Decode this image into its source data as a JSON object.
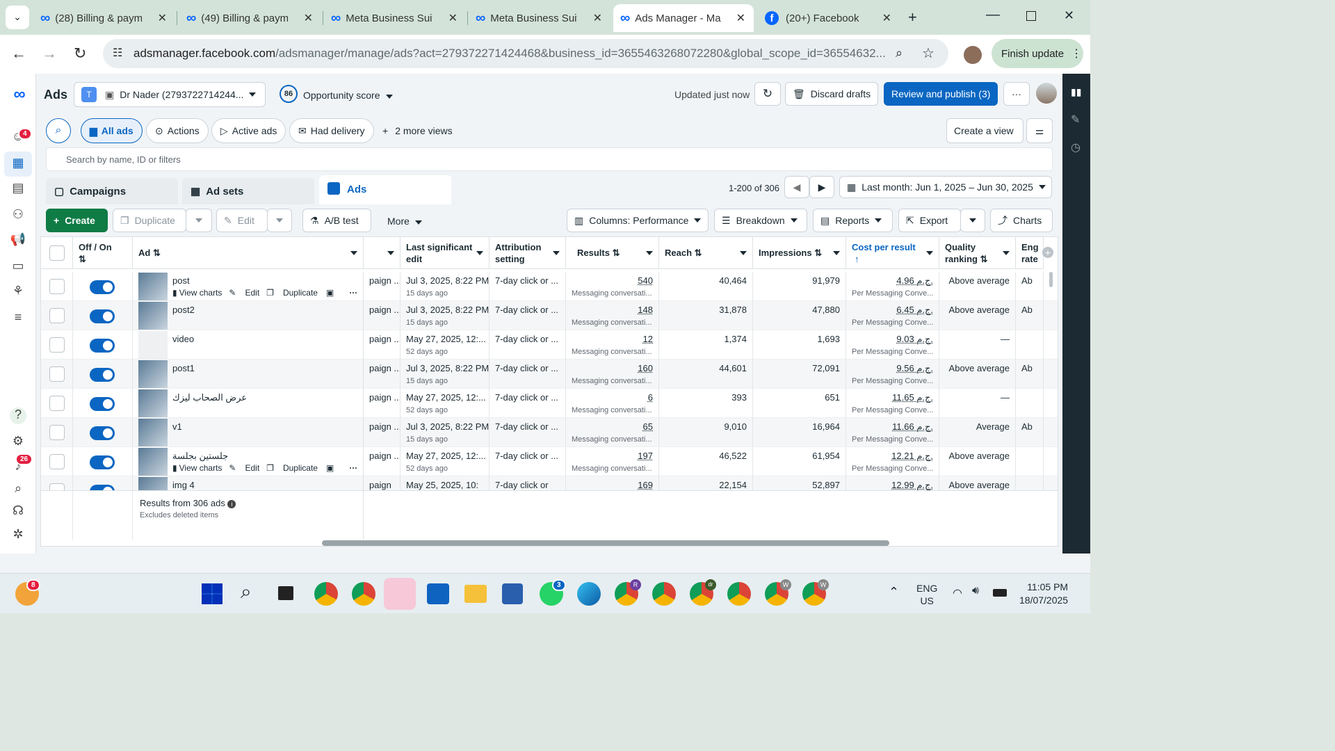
{
  "browser": {
    "tabs": [
      {
        "title": "(28) Billing & paym",
        "icon": "meta-logo-icon"
      },
      {
        "title": "(49) Billing & paym",
        "icon": "meta-logo-icon"
      },
      {
        "title": "Meta Business Suit",
        "icon": "meta-logo-icon"
      },
      {
        "title": "Meta Business Suit",
        "icon": "meta-logo-icon"
      },
      {
        "title": "Ads Manager - Ma",
        "icon": "meta-logo-icon",
        "active": true
      },
      {
        "title": "(20+) Facebook",
        "icon": "facebook-icon"
      }
    ],
    "url_host": "adsmanager.facebook.com",
    "url_path": "/adsmanager/manage/ads?act=279372271424468&business_id=3655463268072280&global_scope_id=36554632...",
    "finish_update": "Finish update"
  },
  "leftnav": {
    "badge_notifications": "4",
    "badge_alerts": "26"
  },
  "header": {
    "title": "Ads",
    "account_initial": "T",
    "account_name": "Dr Nader (2793722714244...",
    "score": "86",
    "opportunity": "Opportunity score",
    "updated": "Updated just now",
    "discard": "Discard drafts",
    "review": "Review and publish (3)",
    "more": "···"
  },
  "views": {
    "all_ads": "All ads",
    "actions": "Actions",
    "active_ads": "Active ads",
    "had_delivery": "Had delivery",
    "more_views": "2 more views",
    "create_view": "Create a view",
    "search_placeholder": "Search by name, ID or filters"
  },
  "level_tabs": {
    "campaigns": "Campaigns",
    "adsets": "Ad sets",
    "ads": "Ads",
    "pagination": "1-200 of 306",
    "date_range": "Last month: Jun 1, 2025 – Jun 30, 2025"
  },
  "toolbar": {
    "create": "Create",
    "duplicate": "Duplicate",
    "edit": "Edit",
    "ab_test": "A/B test",
    "more": "More",
    "columns": "Columns: Performance",
    "breakdown": "Breakdown",
    "reports": "Reports",
    "export": "Export",
    "charts": "Charts"
  },
  "table": {
    "headers": {
      "offon": "Off / On",
      "ad": "Ad",
      "last_edit": "Last significant edit",
      "attribution": "Attribution setting",
      "results": "Results",
      "reach": "Reach",
      "impressions": "Impressions",
      "cpr": "Cost per result",
      "quality": "Quality ranking",
      "eng": "Eng rate"
    },
    "row_actions": {
      "view_charts": "View charts",
      "edit": "Edit",
      "duplicate": "Duplicate"
    },
    "rows": [
      {
        "name": "post",
        "campaign": "paign ...",
        "edit": "Jul 3, 2025, 8:22 PM",
        "edit_ago": "15 days ago",
        "attr": "7-day click or ...",
        "results": "540",
        "results_sub": "Messaging conversati...",
        "reach": "40,464",
        "impr": "91,979",
        "cpr": "4.96 ج.م.",
        "cpr_sub": "Per Messaging Conve...",
        "quality": "Above average",
        "eng": "Ab",
        "actions": true
      },
      {
        "name": "post2",
        "campaign": "paign ...",
        "edit": "Jul 3, 2025, 8:22 PM",
        "edit_ago": "15 days ago",
        "attr": "7-day click or ...",
        "results": "148",
        "results_sub": "Messaging conversati...",
        "reach": "31,878",
        "impr": "47,880",
        "cpr": "6.45 ج.م.",
        "cpr_sub": "Per Messaging Conve...",
        "quality": "Above average",
        "eng": "Ab"
      },
      {
        "name": "video",
        "campaign": "paign ...",
        "edit": "May 27, 2025, 12:...",
        "edit_ago": "52 days ago",
        "attr": "7-day click or ...",
        "results": "12",
        "results_sub": "Messaging conversati...",
        "reach": "1,374",
        "impr": "1,693",
        "cpr": "9.03 ج.م.",
        "cpr_sub": "Per Messaging Conve...",
        "quality": "—",
        "eng": ""
      },
      {
        "name": "post1",
        "campaign": "paign ...",
        "edit": "Jul 3, 2025, 8:22 PM",
        "edit_ago": "15 days ago",
        "attr": "7-day click or ...",
        "results": "160",
        "results_sub": "Messaging conversati...",
        "reach": "44,601",
        "impr": "72,091",
        "cpr": "9.56 ج.م.",
        "cpr_sub": "Per Messaging Conve...",
        "quality": "Above average",
        "eng": "Ab"
      },
      {
        "name": "عرض الصحاب ليزك",
        "campaign": "paign ...",
        "edit": "May 27, 2025, 12:...",
        "edit_ago": "52 days ago",
        "attr": "7-day click or ...",
        "results": "6",
        "results_sub": "Messaging conversati...",
        "reach": "393",
        "impr": "651",
        "cpr": "11.65 ج.م.",
        "cpr_sub": "Per Messaging Conve...",
        "quality": "—",
        "eng": ""
      },
      {
        "name": "v1",
        "campaign": "paign ...",
        "edit": "Jul 3, 2025, 8:22 PM",
        "edit_ago": "15 days ago",
        "attr": "7-day click or ...",
        "results": "65",
        "results_sub": "Messaging conversati...",
        "reach": "9,010",
        "impr": "16,964",
        "cpr": "11.66 ج.م.",
        "cpr_sub": "Per Messaging Conve...",
        "quality": "Average",
        "eng": "Ab"
      },
      {
        "name": "جلستين بجلسة",
        "campaign": "paign ...",
        "edit": "May 27, 2025, 12:...",
        "edit_ago": "52 days ago",
        "attr": "7-day click or ...",
        "results": "197",
        "results_sub": "Messaging conversati...",
        "reach": "46,522",
        "impr": "61,954",
        "cpr": "12.21 ج.م.",
        "cpr_sub": "Per Messaging Conve...",
        "quality": "Above average",
        "eng": "",
        "actions": true
      }
    ],
    "partial_row": {
      "name": "img 4",
      "campaign": "paign",
      "edit": "May 25, 2025, 10:",
      "attr": "7-day click or",
      "results": "169",
      "reach": "22,154",
      "impr": "52,897",
      "cpr": "12.99 ج.م.",
      "quality": "Above average"
    },
    "footer_results": "Results from 306 ads",
    "footer_sub": "Excludes deleted items"
  },
  "taskbar": {
    "lang": "ENG",
    "region": "US",
    "time": "11:05 PM",
    "date": "18/07/2025",
    "badge_weather": "8",
    "badge_whatsapp": "3",
    "avatar_letters": [
      "R",
      "dr",
      "W",
      "W"
    ]
  }
}
